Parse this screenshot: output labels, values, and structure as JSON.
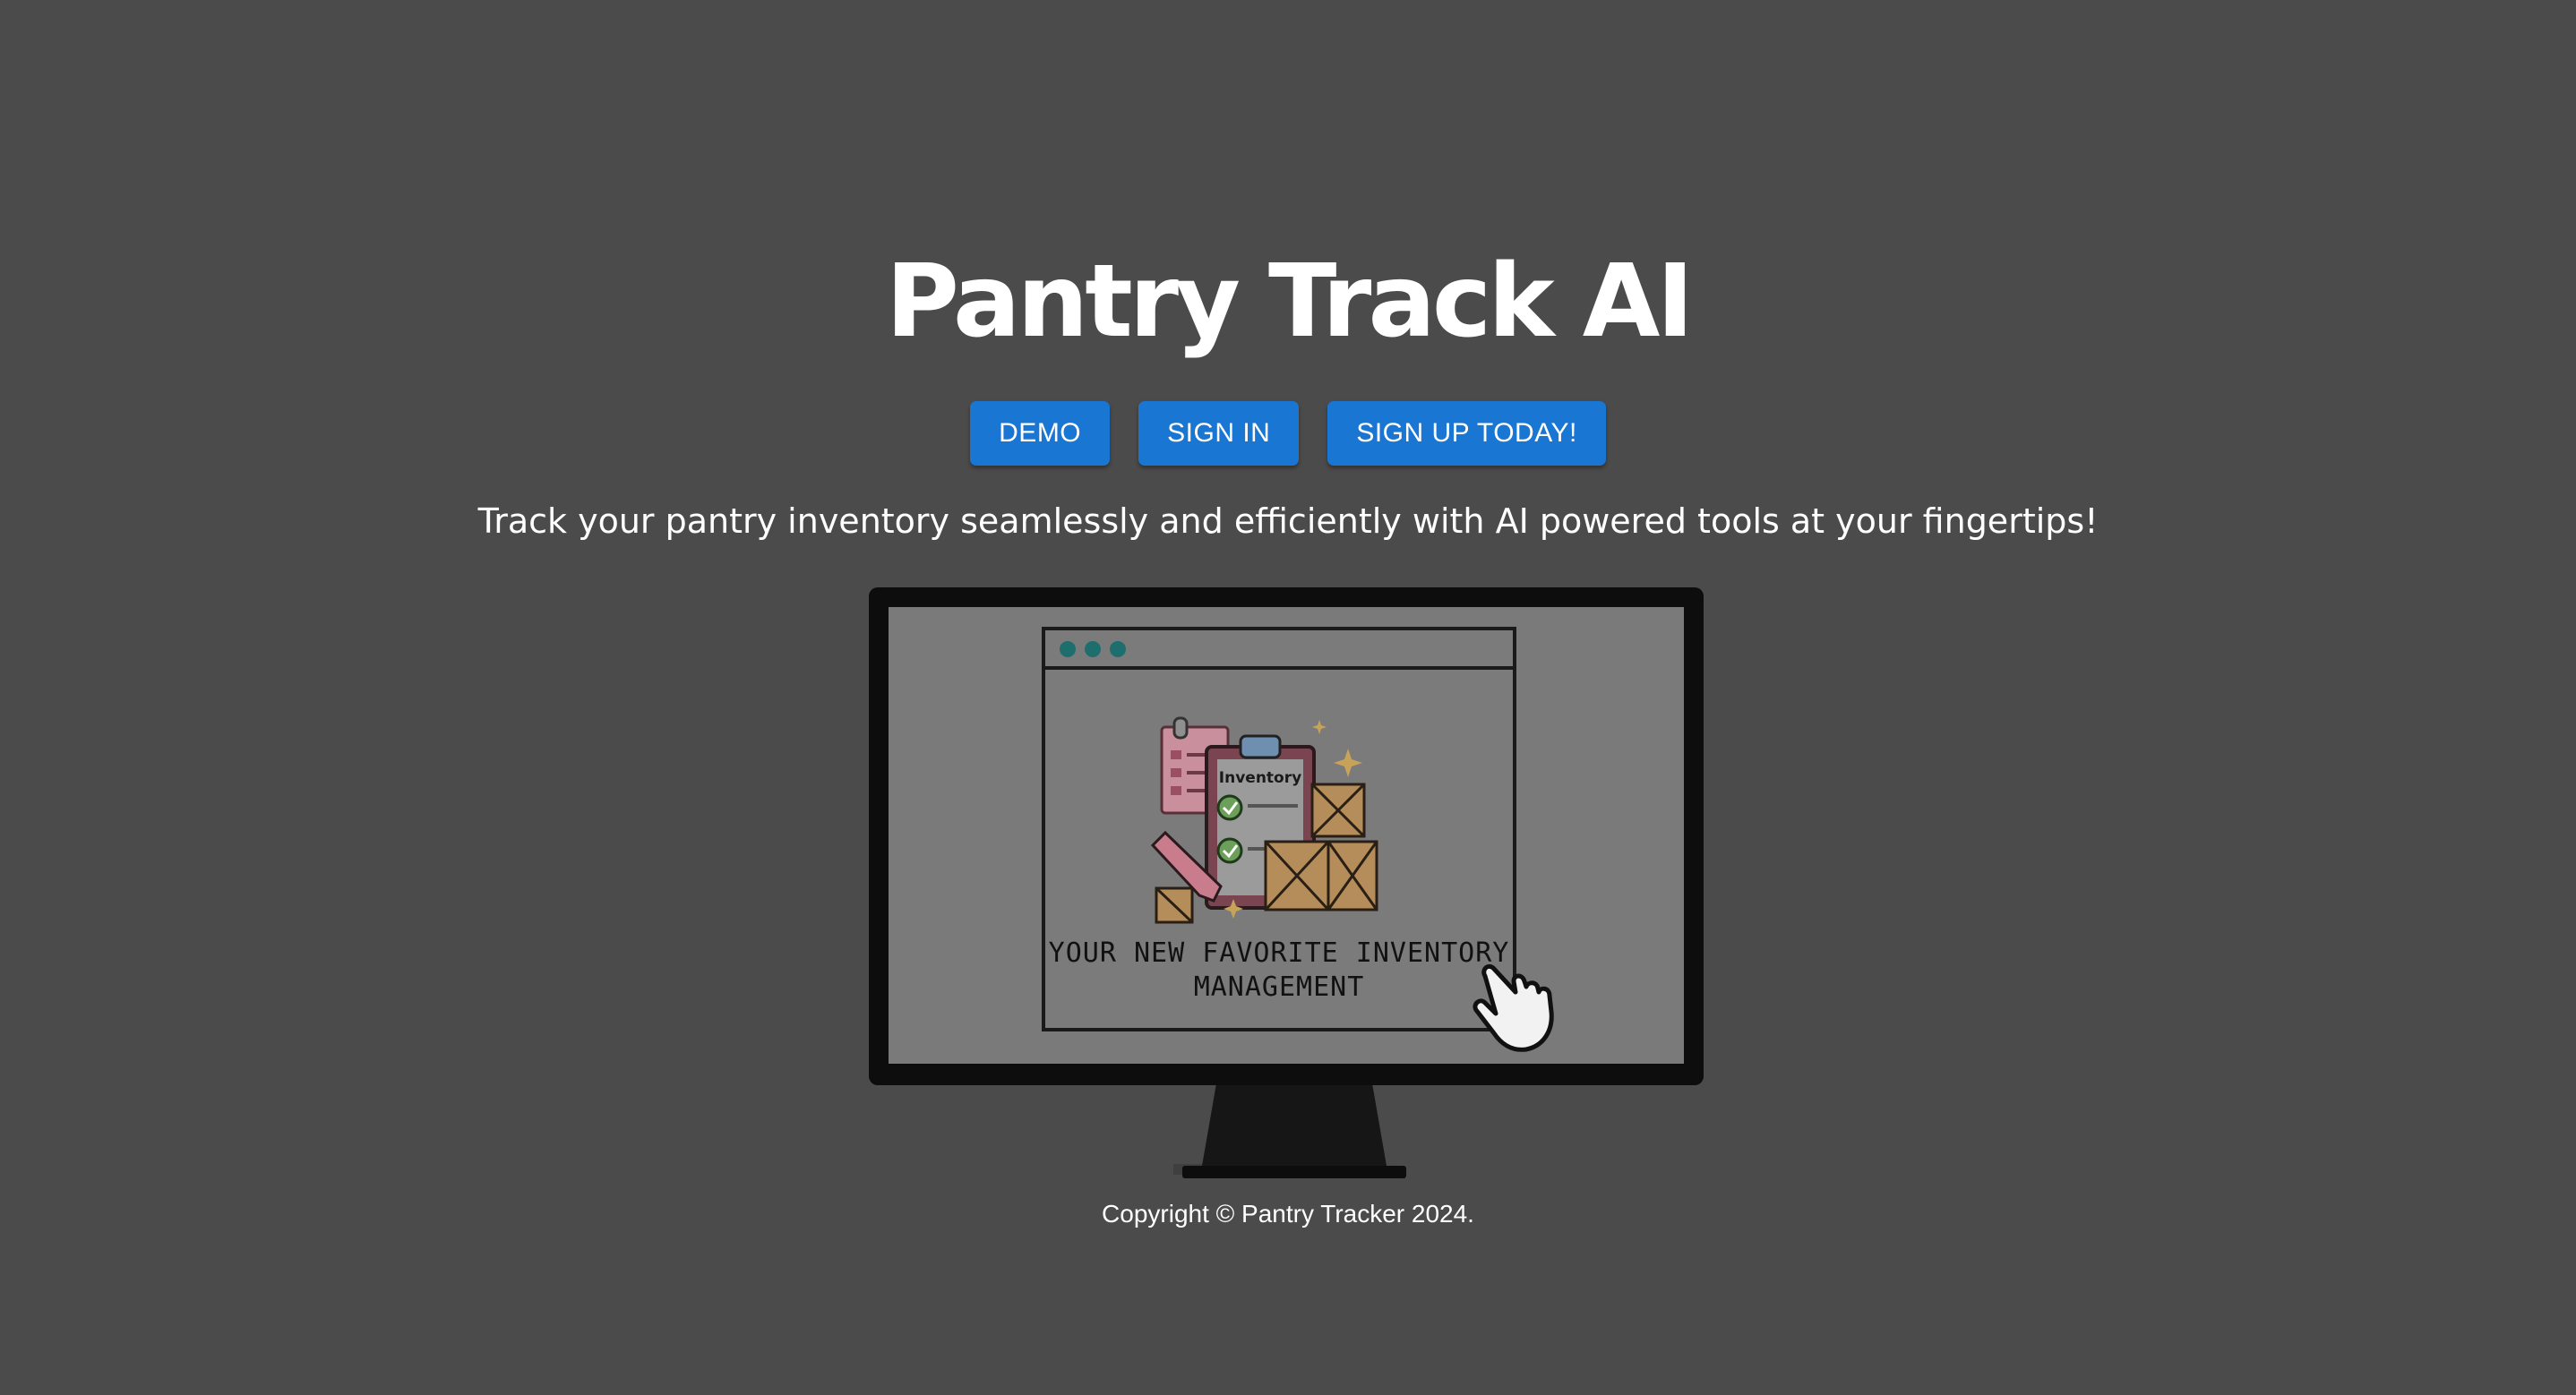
{
  "app": {
    "title": "Pantry Track AI",
    "tagline": "Track your pantry inventory seamlessly and efficiently with AI powered tools at your fingertips!",
    "copyright": "Copyright © Pantry Tracker 2024."
  },
  "buttons": {
    "demo": "DEMO",
    "sign_in": "SIGN IN",
    "sign_up": "SIGN UP TODAY!"
  },
  "hero": {
    "clipboard_label": "Inventory",
    "caption_line1": "YOUR NEW FAVORITE INVENTORY",
    "caption_line2": "MANAGEMENT"
  },
  "colors": {
    "background": "#4b4b4b",
    "button": "#1976d2",
    "text": "#ffffff"
  }
}
